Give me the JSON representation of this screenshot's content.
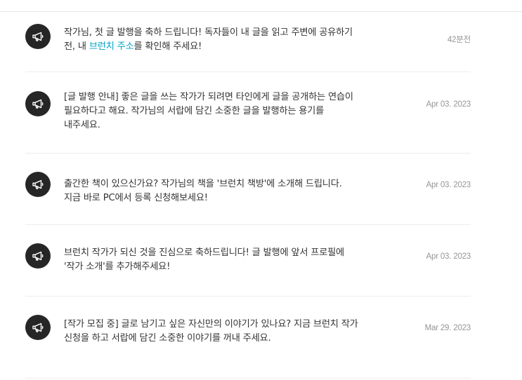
{
  "notifications": [
    {
      "text_before": "작가님, 첫 글 발행을 축하 드립니다! 독자들이 내 글을 읽고 주변에 공유하기 전, 내 ",
      "link_text": "브런치 주소",
      "text_after": "를 확인해 주세요!",
      "time": "42분전"
    },
    {
      "text": "[글 발행 안내] 좋은 글을 쓰는 작가가 되려면 타인에게 글을 공개하는 연습이 필요하다고 해요. 작가님의 서랍에 담긴 소중한 글을 발행하는 용기를 내주세요.",
      "time": "Apr 03. 2023"
    },
    {
      "text": "출간한 책이 있으신가요? 작가님의 책을 '브런치 책방'에 소개해 드립니다. 지금 바로 PC에서 등록 신청해보세요!",
      "time": "Apr 03. 2023"
    },
    {
      "text": "브런치 작가가 되신 것을 진심으로 축하드립니다! 글 발행에 앞서 프로필에 '작가 소개'를 추가해주세요!",
      "time": "Apr 03. 2023"
    },
    {
      "text": "[작가 모집 중] 글로 남기고 싶은 자신만의 이야기가 있나요? 지금 브런치 작가 신청을 하고 서랍에 담긴 소중한 이야기를 꺼내 주세요.",
      "time": "Mar 29. 2023"
    }
  ],
  "icon": "megaphone-icon",
  "colors": {
    "avatar_bg": "#262626",
    "link": "#00a4c8",
    "text": "#333333",
    "date": "#959595",
    "divider": "#eeeeee"
  }
}
